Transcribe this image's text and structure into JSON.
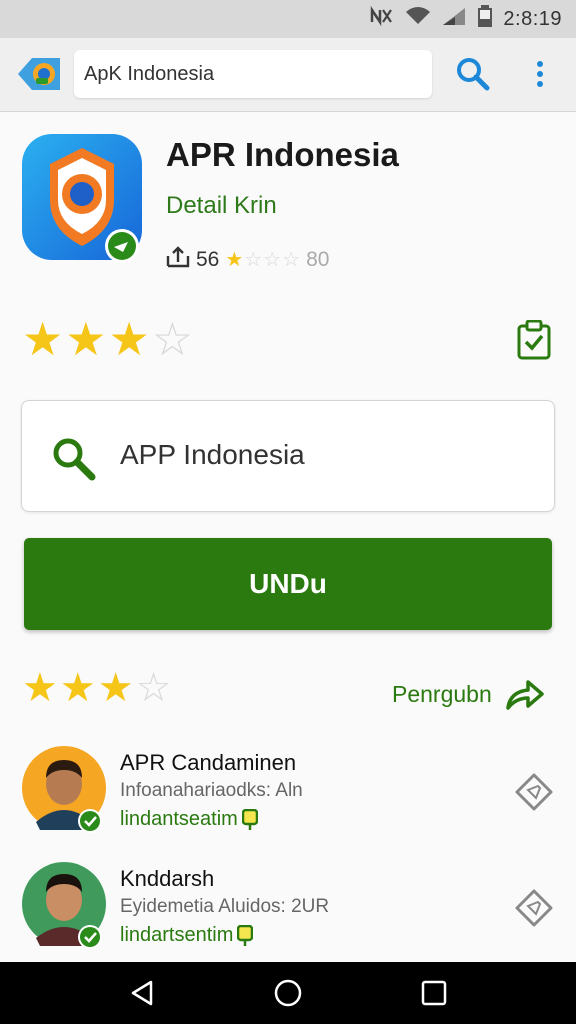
{
  "status_bar": {
    "icons": [
      "nfc-off-icon",
      "wifi-icon",
      "signal-icon",
      "battery-icon"
    ],
    "time": "2:8:19"
  },
  "app_bar": {
    "back_icon": "app-back-icon",
    "search_value": "ApK Indonesia",
    "search_icon": "search-icon",
    "menu_icon": "overflow-menu-icon"
  },
  "app": {
    "title": "APR Indonesia",
    "subtitle": "Detail Krin",
    "rating_text": "56",
    "meta_stars_filled": 1,
    "meta_stars_total": 4,
    "meta_suffix": "80",
    "share_icon": "share-icon"
  },
  "rating": {
    "filled": 3,
    "total": 4,
    "clipboard_icon": "clipboard-check-icon"
  },
  "search_card": {
    "icon": "search-icon",
    "text": "APP Indonesia"
  },
  "download_button": {
    "label": "UNDu"
  },
  "reviews_header": {
    "filled": 3,
    "total": 4,
    "link_label": "Penrgubn",
    "link_icon": "share-arrow-icon"
  },
  "reviews": [
    {
      "name": "APR Candaminen",
      "desc": "Infoanahariaodks: Aln",
      "tag": "lindantseatim",
      "avatar_bg": "#f5a623"
    },
    {
      "name": "Knddarsh",
      "desc": "Eyidemetia Aluidos: 2UR",
      "tag": "lindartsentim",
      "avatar_bg": "#3f9a5b"
    }
  ],
  "colors": {
    "accent_green": "#2a7a10",
    "star_yellow": "#f5c518",
    "nav_bar": "#000000"
  }
}
